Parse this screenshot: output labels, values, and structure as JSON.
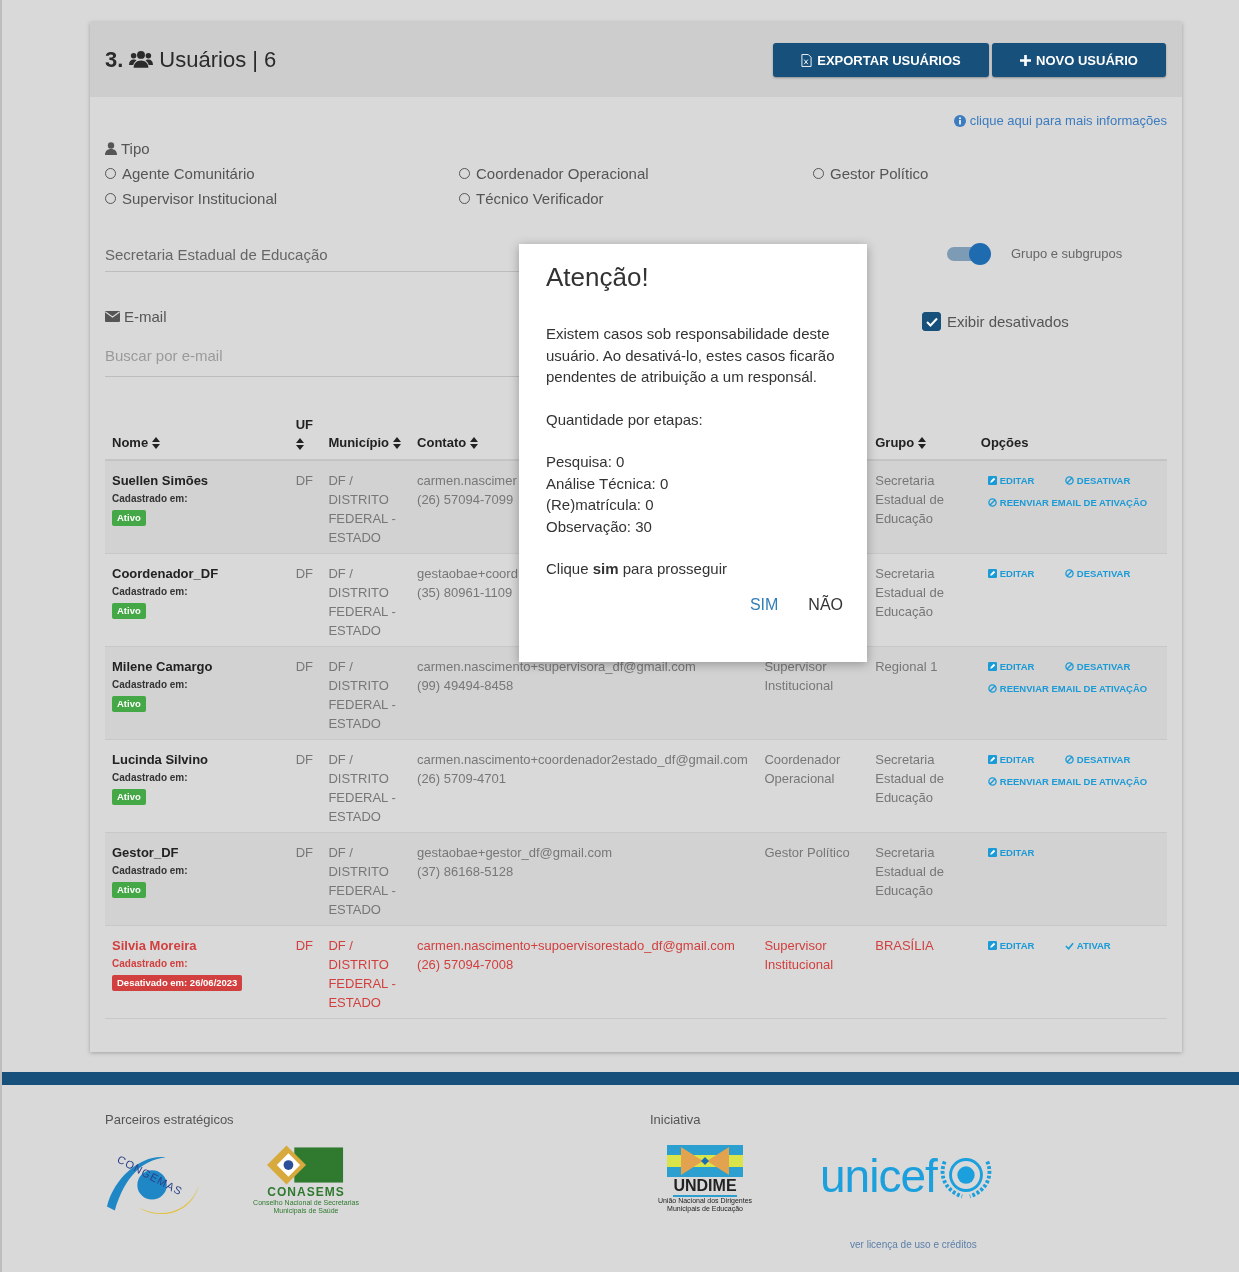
{
  "header": {
    "number": "3.",
    "title": "Usuários | 6",
    "buttons": [
      {
        "kind": "export",
        "label": "EXPORTAR USUÁRIOS"
      },
      {
        "kind": "new",
        "label": "NOVO USUÁRIO"
      }
    ]
  },
  "info_link": "clique aqui para mais informações",
  "type_filter": {
    "label": "Tipo",
    "options": [
      {
        "label": "Agente Comunitário",
        "selected": false
      },
      {
        "label": "Coordenador Operacional",
        "selected": false
      },
      {
        "label": "Gestor Político",
        "selected": false
      },
      {
        "label": "Supervisor Institucional",
        "selected": false
      },
      {
        "label": "Técnico Verificador",
        "selected": false
      }
    ]
  },
  "group_field": {
    "value": "Secretaria Estadual de Educação"
  },
  "group_toggle": {
    "label": "Grupo e subgrupos",
    "on": true
  },
  "email_filter": {
    "label": "E-mail",
    "placeholder": "Buscar por e-mail"
  },
  "show_disabled": {
    "label": "Exibir desativados",
    "checked": true
  },
  "table": {
    "columns": [
      {
        "label": "Nome",
        "sortable": true
      },
      {
        "label": "UF",
        "sortable": true
      },
      {
        "label": "Município",
        "sortable": true
      },
      {
        "label": "Contato",
        "sortable": true
      },
      {
        "label": "Grupo",
        "sortable": true
      },
      {
        "label": "Opções",
        "sortable": false
      }
    ],
    "rows": [
      {
        "name": "Suellen Simões",
        "registered": "Cadastrado em:",
        "badge": "Ativo",
        "deactivated": false,
        "uf": "DF",
        "municipality": "DF / DISTRITO FEDERAL - ESTADO",
        "email": "carmen.nascimer",
        "phone": "(26) 57094-7099",
        "group": "Secretaria Estadual de Educação",
        "actions": [
          {
            "kind": "edit",
            "label": "EDITAR"
          },
          {
            "kind": "deactivate",
            "label": "DESATIVAR"
          },
          {
            "kind": "resend",
            "label": "REENVIAR EMAIL DE ATIVAÇÃO"
          }
        ]
      },
      {
        "name": "Coordenador_DF",
        "registered": "Cadastrado em:",
        "badge": "Ativo",
        "deactivated": false,
        "uf": "DF",
        "municipality": "DF / DISTRITO FEDERAL - ESTADO",
        "email": "gestaobae+coord",
        "phone": "(35) 80961-1109",
        "group": "Secretaria Estadual de Educação",
        "actions": [
          {
            "kind": "edit",
            "label": "EDITAR"
          },
          {
            "kind": "deactivate",
            "label": "DESATIVAR"
          }
        ]
      },
      {
        "name": "Milene Camargo",
        "registered": "Cadastrado em:",
        "badge": "Ativo",
        "deactivated": false,
        "uf": "DF",
        "municipality": "DF / DISTRITO FEDERAL - ESTADO",
        "email": "carmen.nascimento+supervisora_df@gmail.com",
        "phone": "(99) 49494-8458",
        "column_5": "Supervisor Institucional",
        "group": "Regional 1",
        "actions": [
          {
            "kind": "edit",
            "label": "EDITAR"
          },
          {
            "kind": "deactivate",
            "label": "DESATIVAR"
          },
          {
            "kind": "resend",
            "label": "REENVIAR EMAIL DE ATIVAÇÃO"
          }
        ]
      },
      {
        "name": "Lucinda Silvino",
        "registered": "Cadastrado em:",
        "badge": "Ativo",
        "deactivated": false,
        "uf": "DF",
        "municipality": "DF / DISTRITO FEDERAL - ESTADO",
        "email": "carmen.nascimento+coordenador2estado_df@gmail.com",
        "phone": "(26) 5709-4701",
        "column_5": "Coordenador Operacional",
        "group": "Secretaria Estadual de Educação",
        "actions": [
          {
            "kind": "edit",
            "label": "EDITAR"
          },
          {
            "kind": "deactivate",
            "label": "DESATIVAR"
          },
          {
            "kind": "resend",
            "label": "REENVIAR EMAIL DE ATIVAÇÃO"
          }
        ]
      },
      {
        "name": "Gestor_DF",
        "registered": "Cadastrado em:",
        "badge": "Ativo",
        "deactivated": false,
        "uf": "DF",
        "municipality": "DF / DISTRITO FEDERAL - ESTADO",
        "email": "gestaobae+gestor_df@gmail.com",
        "phone": "(37) 86168-5128",
        "column_5": "Gestor Político",
        "group": "Secretaria Estadual de Educação",
        "actions": [
          {
            "kind": "edit",
            "label": "EDITAR"
          }
        ]
      },
      {
        "name": "Silvia Moreira",
        "registered": "Cadastrado em:",
        "badge": "Desativado em: 26/06/2023",
        "deactivated": true,
        "uf": "DF",
        "municipality": "DF / DISTRITO FEDERAL - ESTADO",
        "email": "carmen.nascimento+supoervisorestado_df@gmail.com",
        "phone": "(26) 57094-7008",
        "column_5": "Supervisor Institucional",
        "group": "BRASÍLIA",
        "actions": [
          {
            "kind": "edit",
            "label": "EDITAR"
          },
          {
            "kind": "activate",
            "label": "ATIVAR"
          }
        ]
      }
    ]
  },
  "modal": {
    "title": "Atenção!",
    "message": "Existem casos sob responsabilidade deste usuário. Ao desativá-lo, estes casos ficarão pendentes de atribuição a um responsál.",
    "counts_title": "Quantidade por etapas:",
    "counts": [
      "Pesquisa: 0",
      "Análise Técnica: 0",
      "(Re)matrícula: 0",
      "Observação: 30"
    ],
    "confirm_text": "Clique **sim** para prosseguir",
    "buttons": [
      {
        "kind": "primary",
        "label": "SIM"
      },
      {
        "kind": "secondary",
        "label": "NÃO"
      }
    ]
  },
  "footer": {
    "partners_title": "Parceiros estratégicos",
    "partners": [
      {
        "kind": "congemas",
        "name": "CONGEMAS"
      },
      {
        "kind": "conasems",
        "name": "CONASEMS",
        "subtitle": "Conselho Nacional de Secretarias Municipais de Saúde"
      }
    ],
    "initiative_title": "Iniciativa",
    "initiatives": [
      {
        "kind": "undime",
        "name": "UNDIME",
        "subtitle": "União Nacional dos Dirigentes Municipais de Educação"
      },
      {
        "kind": "unicef",
        "name": "unicef"
      }
    ],
    "credits_link": "ver licença de uso e créditos"
  }
}
